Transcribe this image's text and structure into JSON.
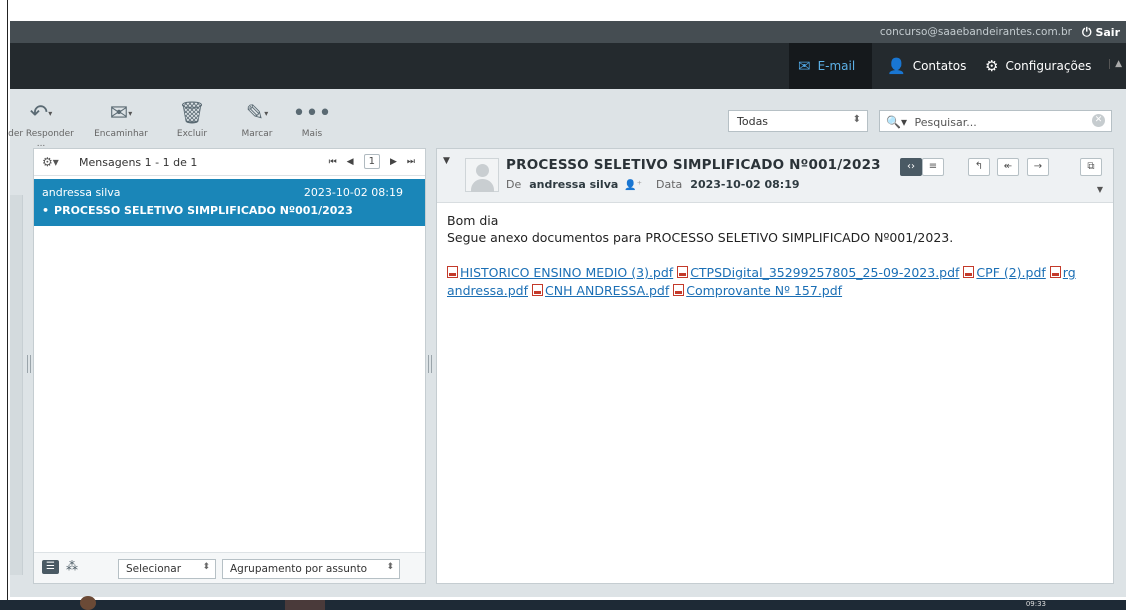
{
  "topbar": {
    "user_email": "concurso@saaebandeirantes.com.br",
    "logout_label": "Sair"
  },
  "nav": {
    "mail_label": "E-mail",
    "contacts_label": "Contatos",
    "settings_label": "Configurações"
  },
  "toolbar": {
    "reply_label": "der  Responder ...",
    "forward_label": "Encaminhar",
    "delete_label": "Excluir",
    "mark_label": "Marcar",
    "more_label": "Mais",
    "filter_value": "Todas",
    "search_placeholder": "Pesquisar..."
  },
  "message_list": {
    "count_label": "Mensagens 1 - 1 de 1",
    "current_page": "1",
    "messages": [
      {
        "from": "andressa silva",
        "date": "2023-10-02 08:19",
        "subject": "PROCESSO SELETIVO SIMPLIFICADO Nº001/2023"
      }
    ],
    "footer": {
      "select_label": "Selecionar",
      "grouping_label": "Agrupamento por assunto"
    }
  },
  "preview": {
    "subject": "PROCESSO SELETIVO SIMPLIFICADO Nº001/2023",
    "from_label": "De",
    "from_name": "andressa silva",
    "date_label": "Data",
    "date_value": "2023-10-02 08:19",
    "body_lines": [
      "Bom dia",
      "Segue anexo documentos para PROCESSO SELETIVO SIMPLIFICADO Nº001/2023."
    ],
    "attachments": [
      "HISTORICO ENSINO MEDIO (3).pdf",
      "CTPSDigital_35299257805_25-09-2023.pdf",
      "CPF (2).pdf",
      "rg andressa.pdf",
      "CNH ANDRESSA.pdf",
      "Comprovante Nº 157.pdf"
    ]
  },
  "taskbar": {
    "clock": "09:33"
  },
  "colors": {
    "selection": "#1a86b8",
    "active_tab": "#4fa4e0",
    "link": "#1b6fb5",
    "header_dark": "#242a2e"
  }
}
